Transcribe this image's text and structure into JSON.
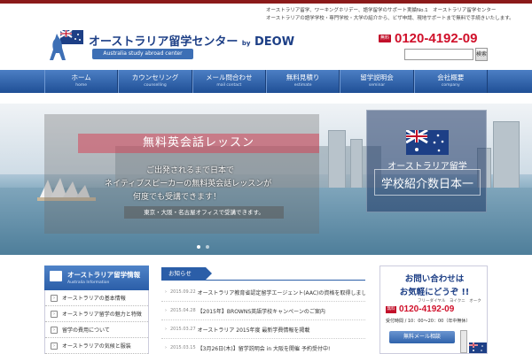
{
  "header": {
    "intro_line1": "オーストラリア留学、ワーキングホリデー、語学留学のサポート実績No.1　オーストラリア留学センター",
    "intro_line2": "オーストラリアの語学学校・専門学校・大学の紹介から、ビザ申請、現地サポートまで無料で手続きいたします。",
    "logo_title": "オーストラリア留学センター",
    "logo_by": "by",
    "logo_brand": "DEOW",
    "logo_subtitle": "Australia study abroad center",
    "phone_badge": "無料",
    "phone_number": "0120-4192-09",
    "search_button": "検索",
    "search_placeholder": ""
  },
  "nav": [
    {
      "jp": "ホーム",
      "en": "home"
    },
    {
      "jp": "カウンセリング",
      "en": "counselling"
    },
    {
      "jp": "メール問合わせ",
      "en": "mail contact"
    },
    {
      "jp": "無料見積り",
      "en": "estimate"
    },
    {
      "jp": "留学説明会",
      "en": "seminar"
    },
    {
      "jp": "会社概要",
      "en": "company"
    }
  ],
  "hero": {
    "title": "無料英会話レッスン",
    "line1": "ご出発されるまで日本で",
    "line2": "ネイティブスピーカーの無料英会話レッスンが",
    "line3": "何度でも受講できます！",
    "sub": "東京・大阪・名古屋オフィスで受講できます。",
    "banner_line1": "オーストラリア留学",
    "banner_line2": "学校紹介数日本一"
  },
  "sidebar": {
    "title": "オーストラリア留学情報",
    "subtitle": "Australia Information",
    "items": [
      "オーストラリアの基本情報",
      "オーストラリア留学の魅力と特徴",
      "留学の費用について",
      "オーストラリアの気候と服装"
    ]
  },
  "news": {
    "tab_label": "お知らせ",
    "items": [
      {
        "date": "2015.09.22",
        "text": "オーストラリア教育省認定留学エージェント(AAC)の資格を取得しました"
      },
      {
        "date": "2015.04.28",
        "text": "【2015年】BROWNS英語学校キャンペーンのご案内"
      },
      {
        "date": "2015.03.27",
        "text": "オーストラリア 2015年度 最新学費情報を掲載"
      },
      {
        "date": "2015.03.15",
        "text": "【3月26日(木)】留学説明会 in 大阪を開催 予約受付中!"
      }
    ]
  },
  "contact": {
    "heading1": "お問い合わせは",
    "heading2": "お気軽にどうぞ !!",
    "kana": "フリーダイヤル　ヨイクニ　オーク",
    "phone_badge": "無料",
    "phone_number": "0120-4192-09",
    "hours": "受付時間 / 10：00～20：00（年中無休）",
    "mail_button": "無料メール相談"
  }
}
